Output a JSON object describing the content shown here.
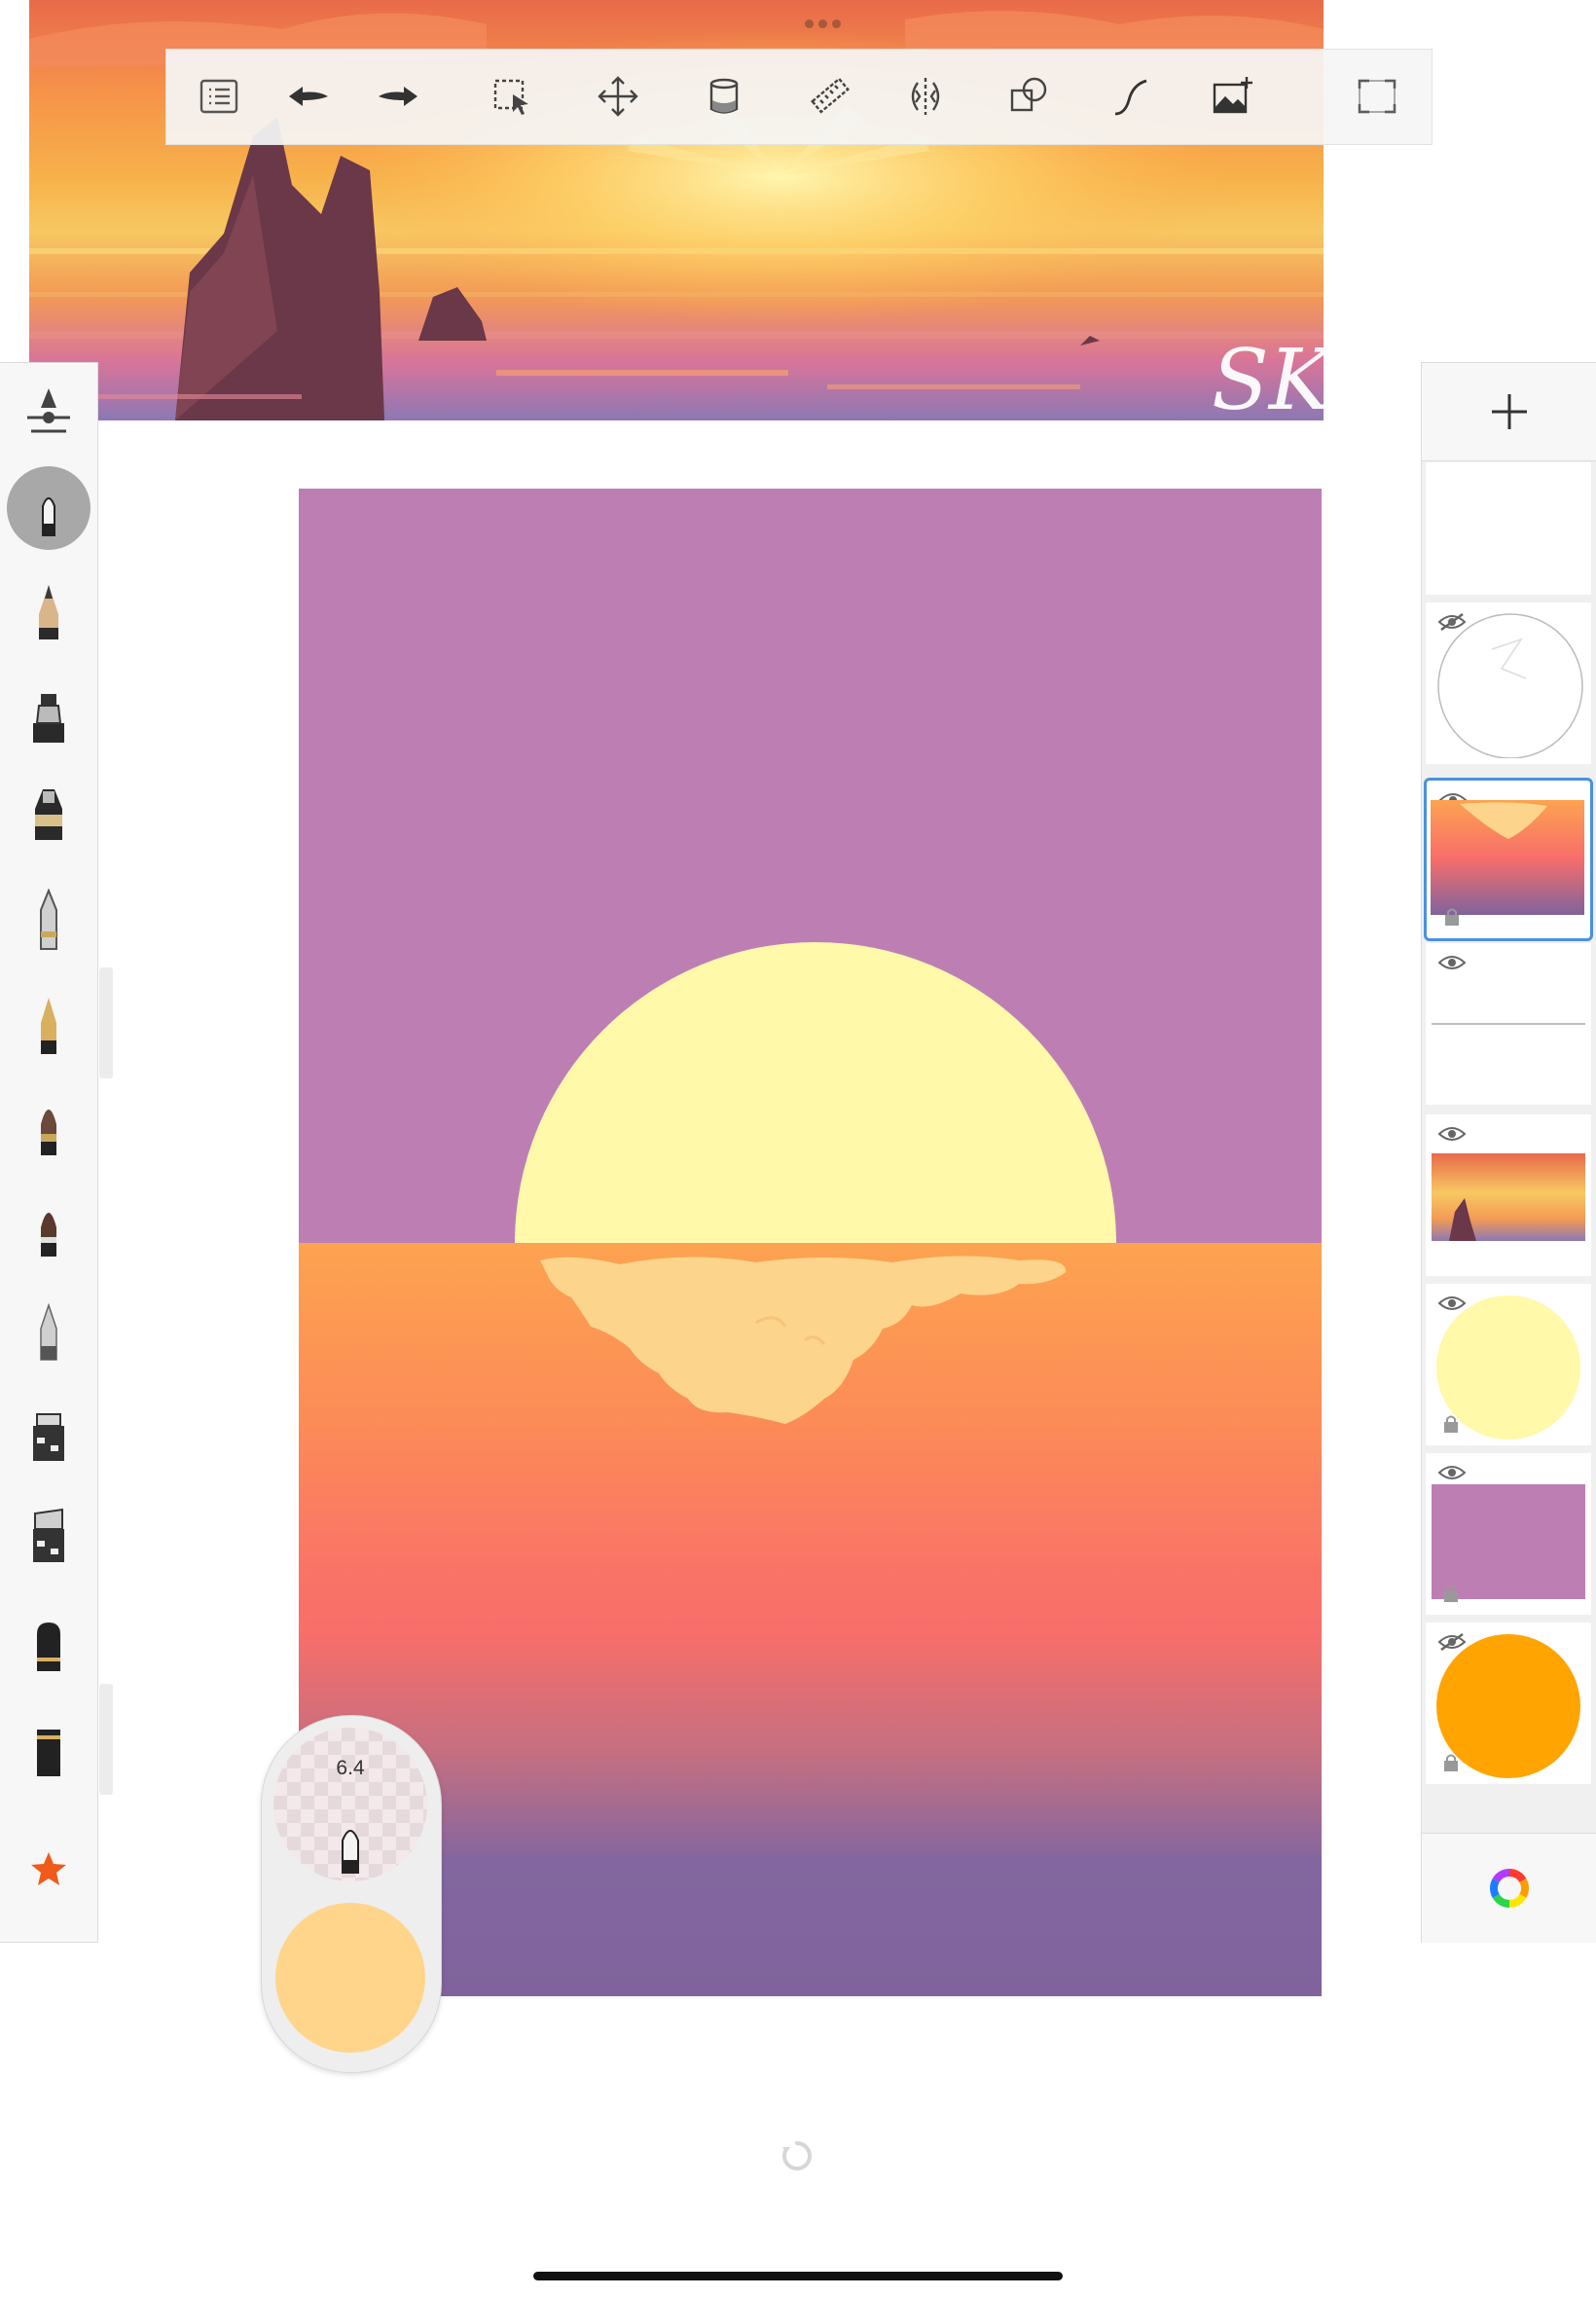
{
  "reference_image": {
    "signature_text": "SK",
    "colors": {
      "sky_top": "#e86a4a",
      "sun_glow": "#f7c862",
      "horizon": "#8c78b4",
      "rocks": "#6a3848"
    }
  },
  "toolbar": {
    "grip": "more-dots",
    "buttons": [
      {
        "name": "layers-list",
        "icon": "list-icon"
      },
      {
        "name": "undo",
        "icon": "undo-icon"
      },
      {
        "name": "redo",
        "icon": "redo-icon"
      },
      {
        "name": "selection",
        "icon": "selection-icon"
      },
      {
        "name": "transform",
        "icon": "move-icon"
      },
      {
        "name": "fill",
        "icon": "paint-bucket-icon"
      },
      {
        "name": "ruler",
        "icon": "ruler-icon"
      },
      {
        "name": "symmetry",
        "icon": "symmetry-icon"
      },
      {
        "name": "shapes",
        "icon": "shapes-icon"
      },
      {
        "name": "curve",
        "icon": "curve-icon"
      },
      {
        "name": "add-image",
        "icon": "add-image-icon"
      },
      {
        "name": "fullscreen",
        "icon": "fullscreen-icon"
      }
    ]
  },
  "brush_palette": {
    "tools": [
      "brush-settings-icon",
      "airbrush-icon",
      "pencil-icon",
      "marker-icon",
      "ink-pen-icon",
      "ballpoint-icon",
      "fountain-pen-icon",
      "paintbrush-icon",
      "round-brush-icon",
      "blender-icon",
      "chisel-marker-icon",
      "wide-marker-icon",
      "eraser-icon",
      "soft-eraser-icon",
      "favorites-star-icon"
    ],
    "active_tool": "airbrush-icon"
  },
  "canvas": {
    "colors": {
      "sky": "#bd7fb3",
      "sun": "#fff9a9",
      "sea_top": "#fda350",
      "sea_mid": "#f76e6a",
      "sea_bottom": "#80639c",
      "reflection": "#fdd48c"
    }
  },
  "layers": {
    "add_label": "+",
    "items": [
      {
        "name": "layer-top",
        "visible": true
      },
      {
        "name": "sketch-circle",
        "visible": false
      },
      {
        "name": "sea-gradient",
        "visible": true,
        "selected": true,
        "locked": true
      },
      {
        "name": "horizon-line",
        "visible": true
      },
      {
        "name": "reference-photo",
        "visible": true
      },
      {
        "name": "sun",
        "visible": true,
        "locked": true
      },
      {
        "name": "sky",
        "visible": true,
        "locked": true
      },
      {
        "name": "orange-circle",
        "visible": false,
        "locked": true
      }
    ]
  },
  "brush_puck": {
    "size_value": "6.4",
    "color": "#ffd58b"
  }
}
